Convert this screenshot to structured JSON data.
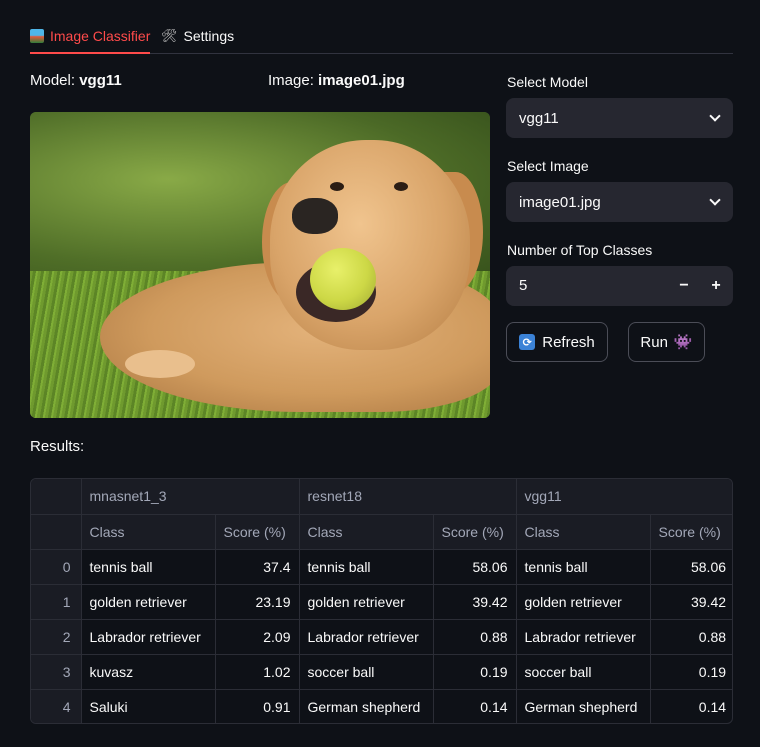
{
  "tabs": [
    {
      "label": "Image Classifier",
      "icon": "picture-icon",
      "active": true
    },
    {
      "label": "Settings",
      "icon": "tools-icon",
      "active": false
    }
  ],
  "caption": {
    "model_label": "Model:",
    "model_value": "vgg11",
    "image_label": "Image:",
    "image_value": "image01.jpg"
  },
  "image": {
    "alt": "golden retriever with tennis ball"
  },
  "controls": {
    "select_model_label": "Select Model",
    "select_model_value": "vgg11",
    "select_image_label": "Select Image",
    "select_image_value": "image01.jpg",
    "top_classes_label": "Number of Top Classes",
    "top_classes_value": "5",
    "minus": "−",
    "plus": "+",
    "refresh_label": "Refresh",
    "run_label": "Run",
    "refresh_icon": "refresh-icon",
    "run_icon": "alien-monster-icon"
  },
  "results": {
    "title": "Results:",
    "models": [
      "mnasnet1_3",
      "resnet18",
      "vgg11"
    ],
    "class_header": "Class",
    "score_header": "Score (%)",
    "rows": [
      {
        "index": "0",
        "cells": [
          [
            "tennis ball",
            "37.4"
          ],
          [
            "tennis ball",
            "58.06"
          ],
          [
            "tennis ball",
            "58.06"
          ]
        ]
      },
      {
        "index": "1",
        "cells": [
          [
            "golden retriever",
            "23.19"
          ],
          [
            "golden retriever",
            "39.42"
          ],
          [
            "golden retriever",
            "39.42"
          ]
        ]
      },
      {
        "index": "2",
        "cells": [
          [
            "Labrador retriever",
            "2.09"
          ],
          [
            "Labrador retriever",
            "0.88"
          ],
          [
            "Labrador retriever",
            "0.88"
          ]
        ]
      },
      {
        "index": "3",
        "cells": [
          [
            "kuvasz",
            "1.02"
          ],
          [
            "soccer ball",
            "0.19"
          ],
          [
            "soccer ball",
            "0.19"
          ]
        ]
      },
      {
        "index": "4",
        "cells": [
          [
            "Saluki",
            "0.91"
          ],
          [
            "German shepherd",
            "0.14"
          ],
          [
            "German shepherd",
            "0.14"
          ]
        ]
      }
    ]
  },
  "colors": {
    "accent": "#ff4b4b",
    "background": "#0e1117",
    "input_bg": "#262730"
  }
}
